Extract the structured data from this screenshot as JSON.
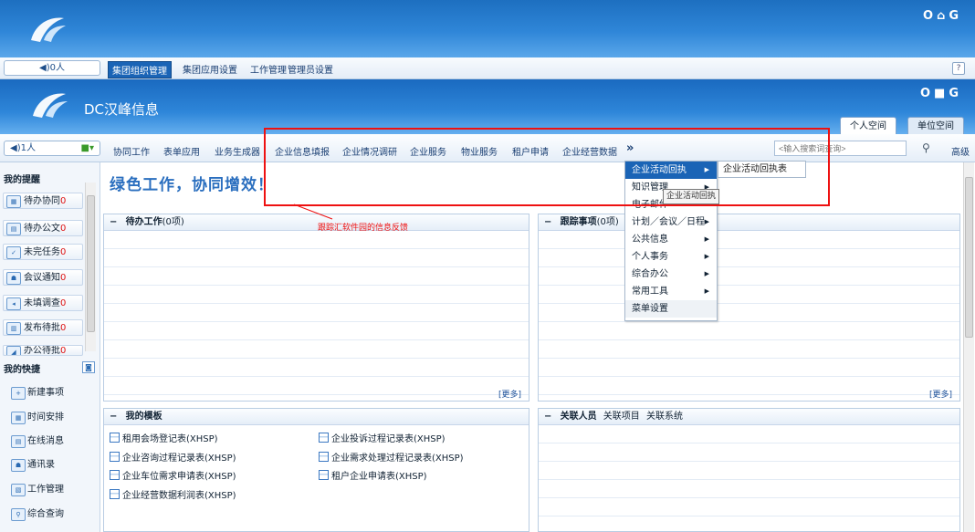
{
  "top_icons": [
    "O",
    "⌂",
    "G"
  ],
  "bar1": {
    "online": "◀)0人",
    "nav": [
      "集团组织管理",
      "集团应用设置",
      "工作管理",
      "管理员设置"
    ],
    "help": "?"
  },
  "header": {
    "brand": "DC汉峰信息",
    "icons": [
      "O",
      "■",
      "G"
    ],
    "tabs": [
      "个人空间",
      "单位空间"
    ]
  },
  "menubar": {
    "online": "◀)1人",
    "items": [
      "协同工作",
      "表单应用",
      "业务生成器",
      "企业信息填报",
      "企业情况调研",
      "企业服务",
      "物业服务",
      "租户申请",
      "企业经营数据"
    ],
    "more": "»",
    "search_placeholder": "<输入搜索词查询>",
    "advanced": "高级"
  },
  "sidebar": {
    "reminder_title": "我的提醒",
    "reminders": [
      {
        "label": "待办协同",
        "count": "0"
      },
      {
        "label": "待办公文",
        "count": "0"
      },
      {
        "label": "未完任务",
        "count": "0"
      },
      {
        "label": "会议通知",
        "count": "0"
      },
      {
        "label": "未填调查",
        "count": "0"
      },
      {
        "label": "发布待批",
        "count": "0"
      },
      {
        "label": "办公待批",
        "count": "0"
      }
    ],
    "shortcut_title": "我的快捷",
    "shortcuts": [
      "新建事项",
      "时间安排",
      "在线消息",
      "通讯录",
      "工作管理",
      "综合查询"
    ]
  },
  "main": {
    "banner": "绿色工作，协同增效！",
    "pending": {
      "title": "待办工作",
      "count": "(0项)",
      "more": "[更多]"
    },
    "tracking": {
      "title": "跟踪事项",
      "count": "(0项)",
      "more": "[更多]"
    },
    "templates": {
      "title": "我的模板",
      "items": [
        "租用会场登记表(XHSP)",
        "企业投诉过程记录表(XHSP)",
        "企业咨询过程记录表(XHSP)",
        "企业需求处理过程记录表(XHSP)",
        "企业车位需求申请表(XHSP)",
        "租户企业申请表(XHSP)",
        "企业经营数据利润表(XHSP)"
      ]
    },
    "related": {
      "tabs": [
        "关联人员",
        "关联项目",
        "关联系统"
      ]
    }
  },
  "dropdown": {
    "items": [
      {
        "label": "企业活动回执",
        "arrow": "▶"
      },
      {
        "label": "知识管理",
        "arrow": "▶"
      },
      {
        "label": "电子邮件",
        "arrow": ""
      },
      {
        "label": "计划／会议／日程",
        "arrow": "▶"
      },
      {
        "label": "公共信息",
        "arrow": "▶"
      },
      {
        "label": "个人事务",
        "arrow": "▶"
      },
      {
        "label": "综合办公",
        "arrow": "▶"
      },
      {
        "label": "常用工具",
        "arrow": "▶"
      },
      {
        "label": "菜单设置",
        "arrow": ""
      }
    ],
    "submenu": "企业活动回执表",
    "tooltip": "企业活动回执"
  },
  "annotation": "跟踪汇软件园的信息反馈",
  "colors": {
    "accent": "#1a64b6",
    "annotation": "#e11111"
  }
}
